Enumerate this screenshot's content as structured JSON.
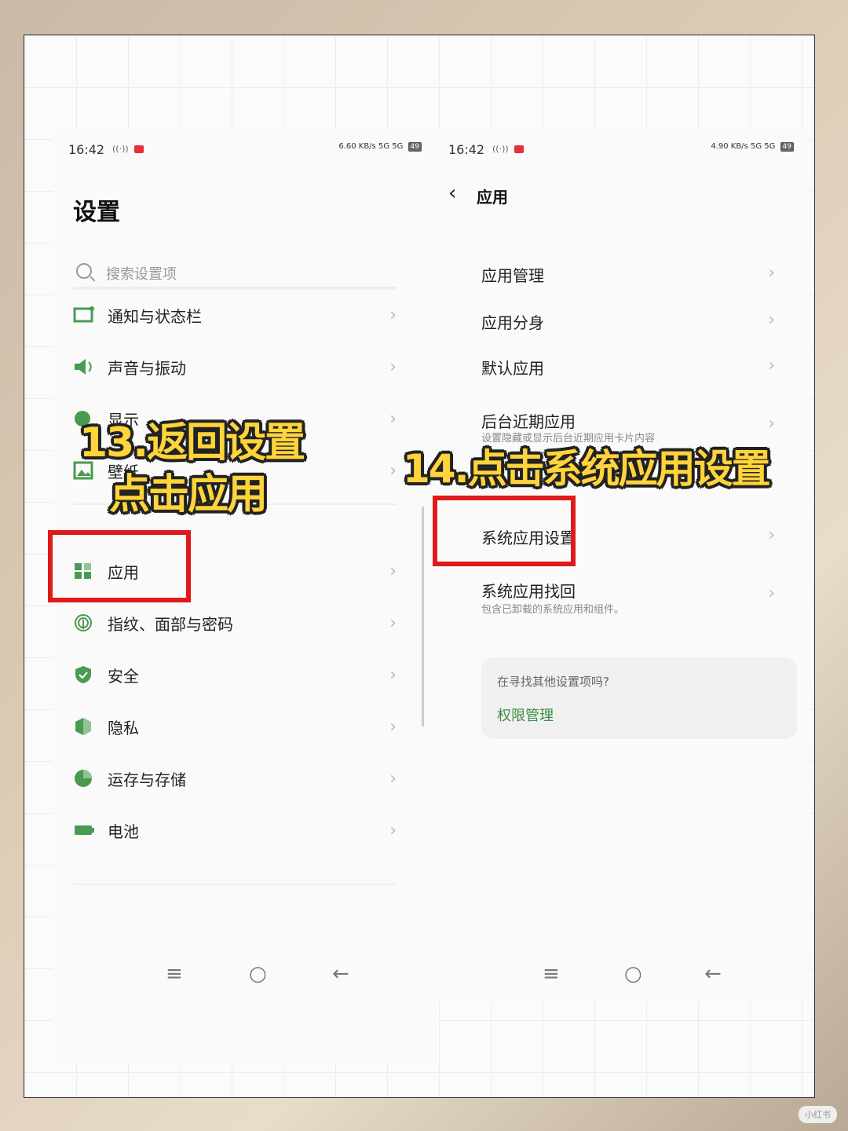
{
  "left": {
    "status": {
      "time": "16:42",
      "speed": "6.60 KB/s",
      "signal": "5G 5G",
      "battery": "49"
    },
    "title": "设置",
    "search_placeholder": "搜索设置项",
    "items": [
      {
        "label": "通知与状态栏",
        "icon": "notification-icon"
      },
      {
        "label": "声音与振动",
        "icon": "speaker-icon"
      },
      {
        "label": "显示",
        "icon": "display-icon"
      },
      {
        "label": "壁纸",
        "icon": "wallpaper-icon"
      },
      {
        "label": "应用",
        "icon": "apps-icon"
      },
      {
        "label": "指纹、面部与密码",
        "icon": "fingerprint-icon"
      },
      {
        "label": "安全",
        "icon": "shield-icon"
      },
      {
        "label": "隐私",
        "icon": "privacy-icon"
      },
      {
        "label": "运存与存储",
        "icon": "storage-icon"
      },
      {
        "label": "电池",
        "icon": "battery-icon"
      }
    ],
    "overlay_line1": "13.返回设置",
    "overlay_line2": "点击应用"
  },
  "right": {
    "status": {
      "time": "16:42",
      "speed": "4.90 KB/s",
      "signal": "5G 5G",
      "battery": "49"
    },
    "title": "应用",
    "items": [
      {
        "label": "应用管理"
      },
      {
        "label": "应用分身"
      },
      {
        "label": "默认应用"
      },
      {
        "label": "后台近期应用",
        "sub": "设置隐藏或显示后台近期应用卡片内容"
      },
      {
        "label": "系统应用设置"
      },
      {
        "label": "系统应用找回",
        "sub": "包含已卸载的系统应用和组件。"
      }
    ],
    "card_question": "在寻找其他设置项吗?",
    "card_link": "权限管理",
    "overlay": "14.点击系统应用设置"
  },
  "nav": {
    "menu": "≡",
    "home": "○",
    "back": "←"
  },
  "colors": {
    "accent_green": "#3b8c45",
    "highlight_red": "#e01a1a",
    "overlay_yellow": "#ffd43a"
  },
  "watermark": "小红书"
}
